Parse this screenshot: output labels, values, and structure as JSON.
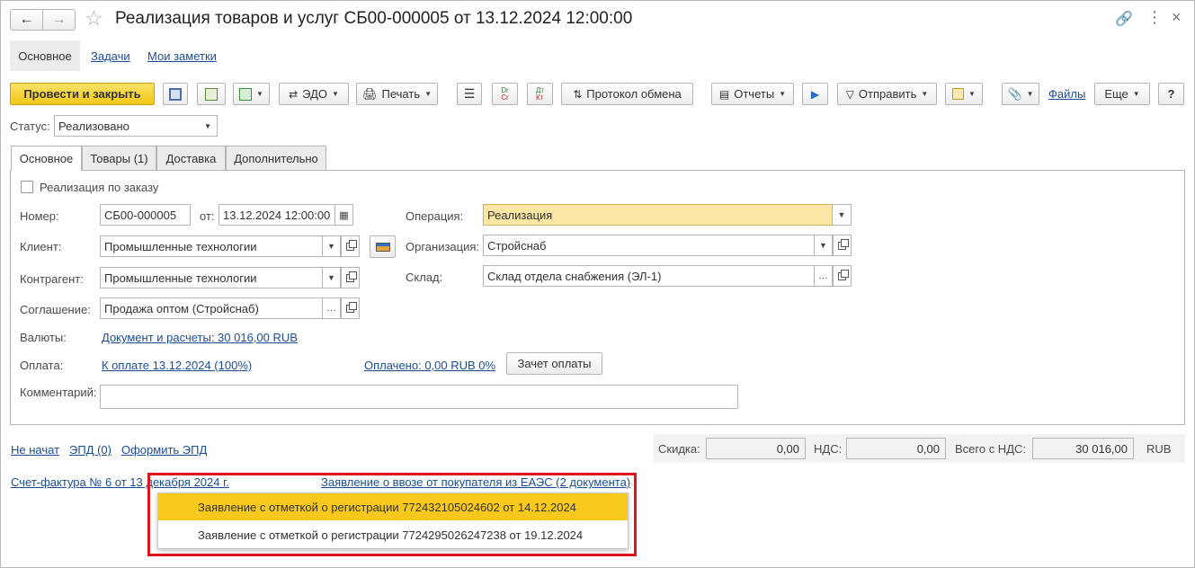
{
  "window": {
    "title": "Реализация товаров и услуг СБ00-000005 от 13.12.2024 12:00:00"
  },
  "nav_tabs": [
    "Основное",
    "Задачи",
    "Мои заметки"
  ],
  "toolbar": {
    "post_close": "Провести и закрыть",
    "edo": "ЭДО",
    "print": "Печать",
    "exchange_log": "Протокол обмена",
    "reports": "Отчеты",
    "send": "Отправить",
    "files": "Файлы",
    "more": "Еще",
    "help": "?",
    "dt_cr": {
      "dr": "Dr",
      "cr": "Cr"
    },
    "dt_kt": {
      "dt": "Дт",
      "kt": "Кт"
    }
  },
  "status": {
    "label": "Статус:",
    "value": "Реализовано"
  },
  "form_tabs": [
    "Основное",
    "Товары (1)",
    "Доставка",
    "Дополнительно"
  ],
  "form": {
    "by_order_label": "Реализация по заказу",
    "number_label": "Номер:",
    "number_value": "СБ00-000005",
    "date_label": "от:",
    "date_value": "13.12.2024 12:00:00",
    "operation_label": "Операция:",
    "operation_value": "Реализация",
    "client_label": "Клиент:",
    "client_value": "Промышленные технологии",
    "organization_label": "Организация:",
    "organization_value": "Стройснаб",
    "counterparty_label": "Контрагент:",
    "counterparty_value": "Промышленные технологии",
    "warehouse_label": "Склад:",
    "warehouse_value": "Склад отдела снабжения (ЭЛ-1)",
    "agreement_label": "Соглашение:",
    "agreement_value": "Продажа оптом (Стройснаб)",
    "currency_label": "Валюты:",
    "currency_link": "Документ и расчеты: 30 016,00 RUB",
    "payment_label": "Оплата:",
    "payment_link": "К оплате 13.12.2024 (100%)",
    "paid_link": "Оплачено: 0,00 RUB 0%",
    "offset_button": "Зачет оплаты",
    "comment_label": "Комментарий:",
    "comment_value": ""
  },
  "footer": {
    "not_started": "Не начат",
    "epd": "ЭПД (0)",
    "make_epd": "Оформить ЭПД",
    "discount_label": "Скидка:",
    "discount_value": "0,00",
    "vat_label": "НДС:",
    "vat_value": "0,00",
    "total_label": "Всего с НДС:",
    "total_value": "30 016,00",
    "currency": "RUB",
    "invoice_link": "Счет-фактура № 6 от 13 декабря 2024 г.",
    "import_link": "Заявление о ввозе от покупателя из ЕАЭС (2 документа)"
  },
  "popup": {
    "items": [
      "Заявление с отметкой о регистрации 772432105024602 от 14.12.2024",
      "Заявление с отметкой о регистрации 7724295026247238 от 19.12.2024"
    ]
  },
  "colors": {
    "primary_button": "#f5d033",
    "selected_item": "#f8c91c",
    "highlight_frame": "#e0131b",
    "link": "#1c4d92",
    "operation_field": "#fde7a4"
  }
}
